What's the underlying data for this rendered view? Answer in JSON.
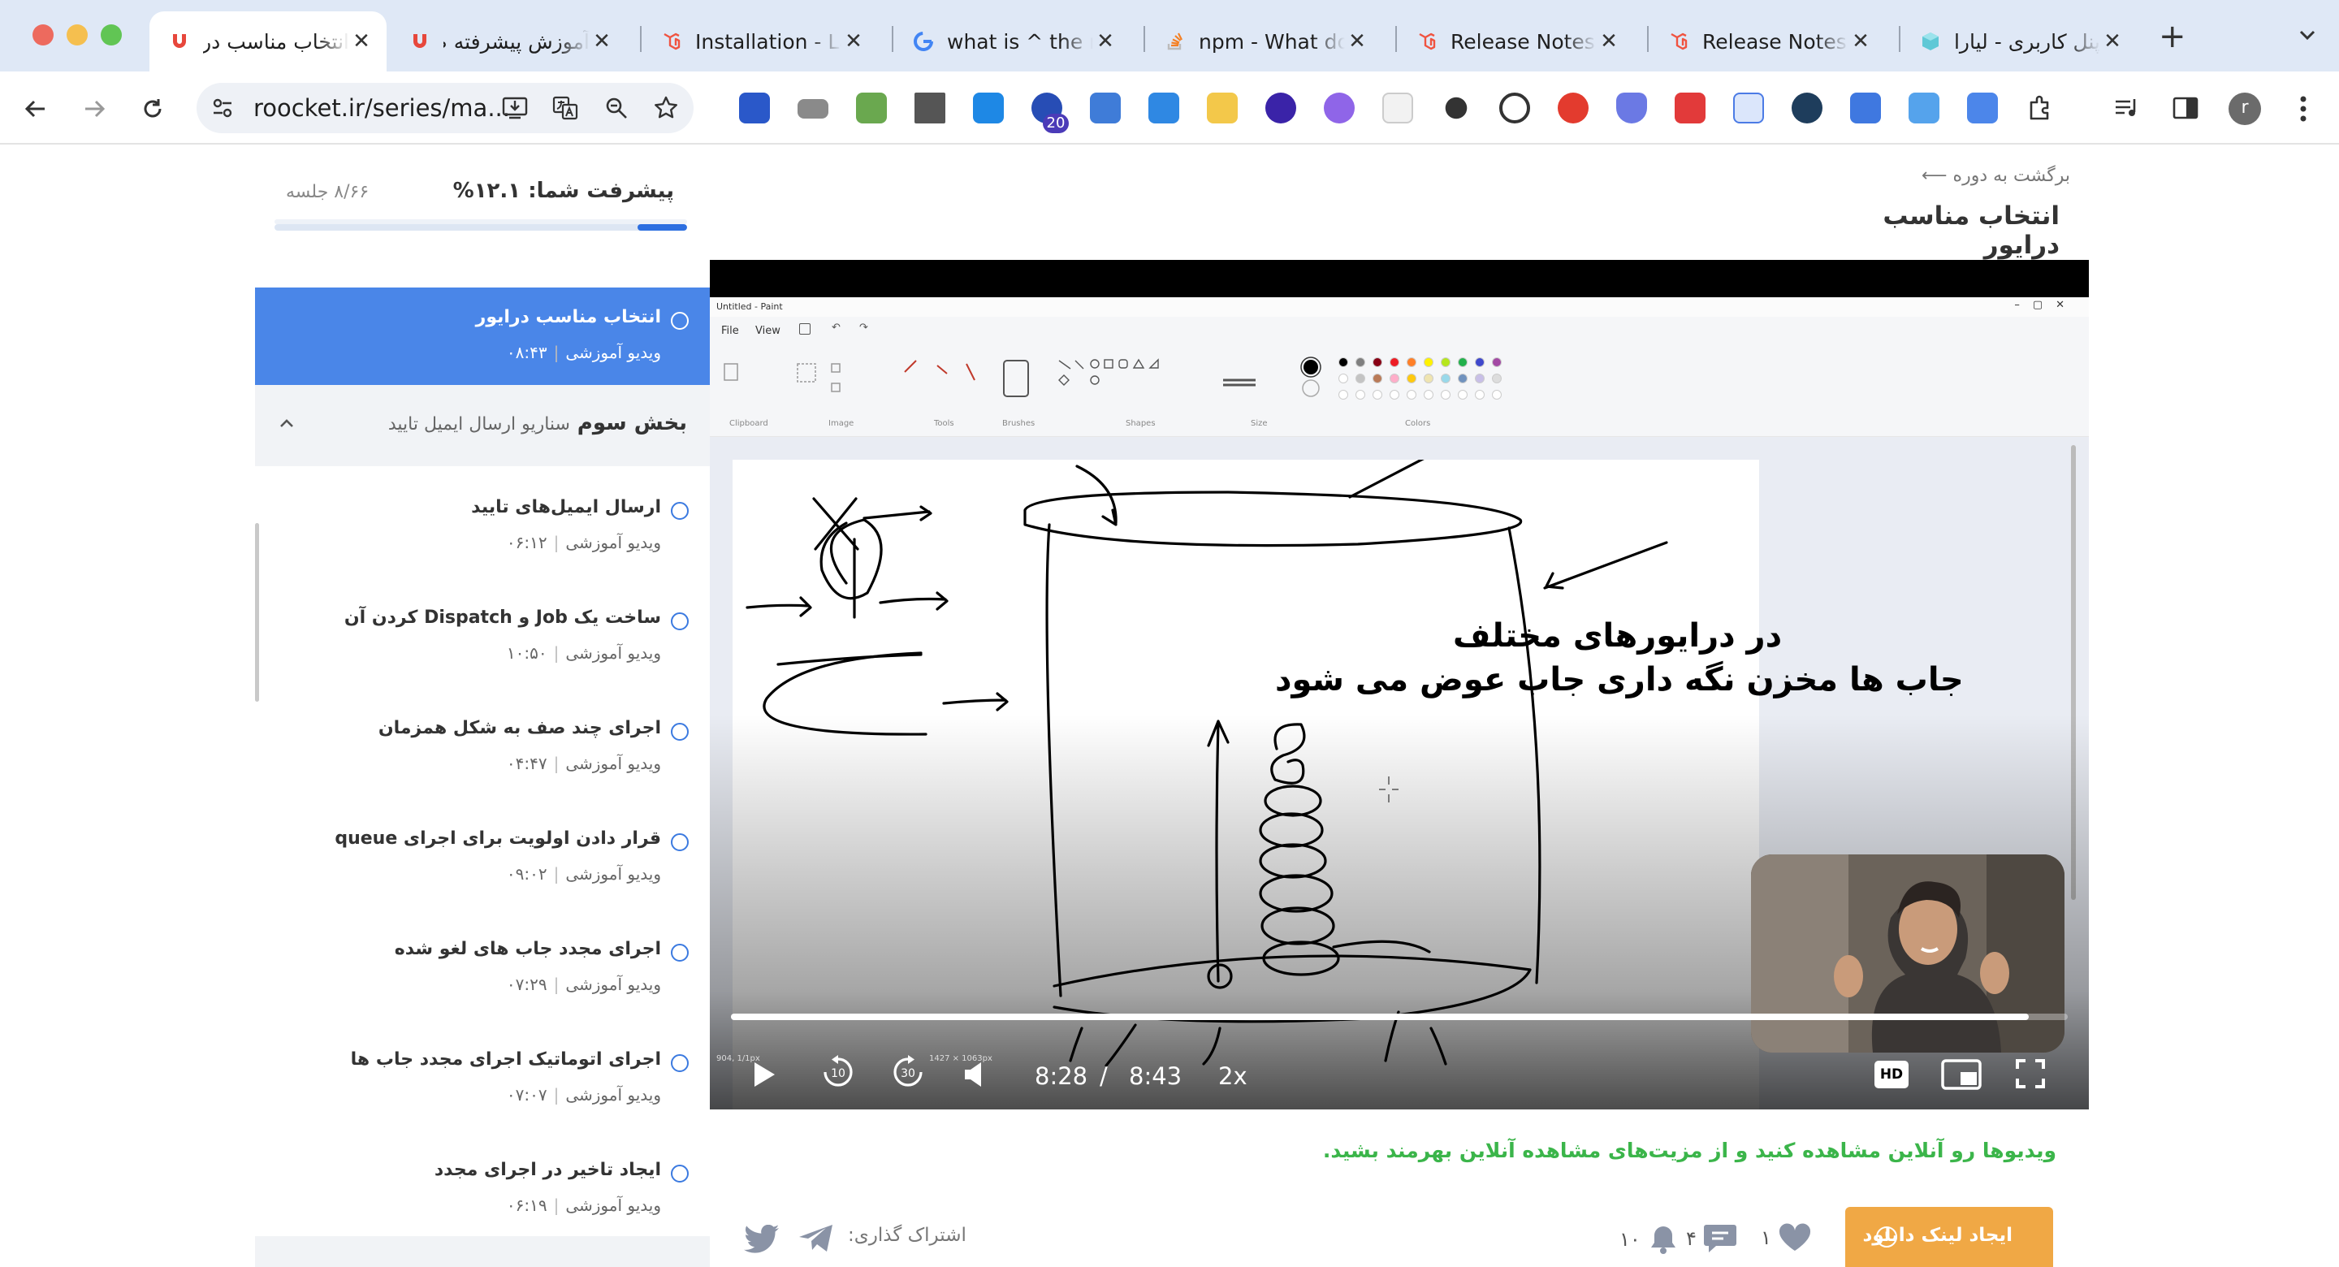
{
  "browser": {
    "tabs": [
      {
        "title": "انتخاب مناسب درایور",
        "icon": "roocket-favicon-icon",
        "active": true
      },
      {
        "title": "آموزش پیشرفته صف",
        "icon": "roocket-favicon-icon",
        "active": false
      },
      {
        "title": "Installation - Laravel",
        "icon": "laravel-favicon-icon",
        "active": false
      },
      {
        "title": "what is ^ the meaning",
        "icon": "google-favicon-icon",
        "active": false
      },
      {
        "title": "npm - What does",
        "icon": "stackoverflow-favicon-icon",
        "active": false
      },
      {
        "title": "Release Notes - Laravel",
        "icon": "laravel-favicon-icon",
        "active": false
      },
      {
        "title": "Release Notes - Laravel",
        "icon": "laravel-favicon-icon",
        "active": false
      },
      {
        "title": "پنل کاربری - لیارا",
        "icon": "liara-favicon-icon",
        "active": false
      }
    ],
    "url": "roocket.ir/series/ma...",
    "extension_badge": "20",
    "profile_initial": "r"
  },
  "sidebar": {
    "progress_label": "پیشرفت شما: ۱۲.۱%",
    "progress_value": 0.121,
    "sessions_count": "۸/۶۶ جلسه",
    "current_lesson": {
      "title": "انتخاب مناسب درایور",
      "type": "ویدیو آموزشی",
      "duration": "۰۸:۴۳"
    },
    "section": {
      "name": "بخش سوم",
      "description": "سناریو ارسال ایمیل تایید"
    },
    "lessons": [
      {
        "title": "ارسال ایمیل‌های تایید",
        "type": "ویدیو آموزشی",
        "duration": "۰۶:۱۲"
      },
      {
        "title": "ساخت یک Job و Dispatch کردن آن",
        "type": "ویدیو آموزشی",
        "duration": "۱۰:۵۰"
      },
      {
        "title": "اجرای چند صف به شکل همزمان",
        "type": "ویدیو آموزشی",
        "duration": "۰۴:۴۷"
      },
      {
        "title": "قرار دادن اولویت برای اجرای queue",
        "type": "ویدیو آموزشی",
        "duration": "۰۹:۰۲"
      },
      {
        "title": "اجرای مجدد جاب های لغو شده",
        "type": "ویدیو آموزشی",
        "duration": "۰۷:۲۹"
      },
      {
        "title": "اجرای اتوماتیک اجرای مجدد جاب ها",
        "type": "ویدیو آموزشی",
        "duration": "۰۷:۰۷"
      },
      {
        "title": "ایجاد تاخیر در اجرای مجدد",
        "type": "ویدیو آموزشی",
        "duration": "۰۶:۱۹"
      }
    ]
  },
  "main": {
    "back_link": "برگشت به دوره",
    "title": "انتخاب مناسب درایور",
    "video": {
      "paint_window_title": "Untitled - Paint",
      "paint_menu": [
        "File",
        "View"
      ],
      "ribbon_groups": [
        "Clipboard",
        "Image",
        "Tools",
        "Brushes",
        "Shapes",
        "Size",
        "Colors"
      ],
      "annotation_line1": "در درایورهای مختلف",
      "annotation_line2": "جاب ها مخزن نگه داری جاب عوض می شود",
      "current_time": "8:28",
      "time_separator": "/",
      "duration": "8:43",
      "progress": 0.971,
      "speed": "2x",
      "quality": "HD",
      "status_left": "904, 1/1px",
      "status_mid": "1427 × 1063px"
    },
    "promo_text": "ویدیوها رو آنلاین مشاهده کنید و از مزیت‌های مشاهده آنلاین بهرمند بشید.",
    "download_button": "ایجاد لینک دانلود",
    "download_icon_text": "!",
    "likes": "۱",
    "comments": "۴",
    "notifications": "۱۰",
    "share_label": "اشتراک گذاری:"
  },
  "colors": {
    "accent": "#4a86e8",
    "promo_green": "#3bb54a",
    "download_orange": "#f0a845"
  }
}
